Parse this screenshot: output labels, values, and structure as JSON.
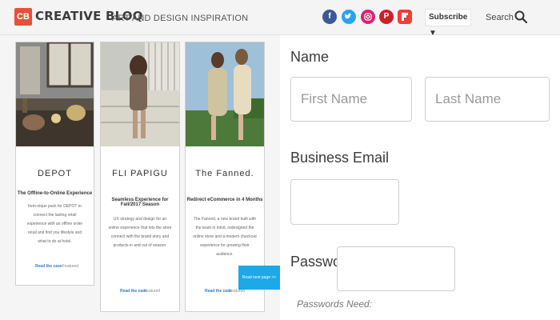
{
  "header": {
    "logo_mark": "CB",
    "logo_text": "CREATIVE BLOQ",
    "tagline": "ART AND DESIGN INSPIRATION",
    "social_icons": [
      "facebook-icon",
      "twitter-icon",
      "instagram-icon",
      "pinterest-icon",
      "flipboard-icon"
    ],
    "subscribe_label": "Subscribe ▼",
    "search_label": "Search"
  },
  "cards": [
    {
      "title": "DEPOT",
      "subtitle": "The Offline-to-Online Experience",
      "body": "Item-nique pack for DEPOT to connect the lasting retail experience with an offline order retail and find you lifestyle and what to do at hotel.",
      "link": "Read the case",
      "tag": "Featured"
    },
    {
      "title": "FLI PAPIGU",
      "subtitle": "Seamless Experience for Fall/2017 Season",
      "body": "UX strategy and design for an online experience that lets the store connect with the brand story and products in and out of season.",
      "link": "Read the case",
      "tag": "Featured"
    },
    {
      "title": "The Fanned.",
      "subtitle": "Redirect eCommerce in 4 Months",
      "body": "The Fanned, a new brand built with the team in mind, redesigned the online store and a modern checkout experience for growing their audience.",
      "link": "Read the case",
      "tag": "Featured"
    }
  ],
  "next_button": "Read next page >>",
  "form": {
    "name_label": "Name",
    "first_name_placeholder": "First Name",
    "last_name_placeholder": "Last Name",
    "email_label": "Business Email",
    "password_label": "Password",
    "password_hint": "Passwords Need:"
  },
  "colors": {
    "brand": "#e8503a",
    "accent": "#1ba9e8",
    "link": "#2a7bd6"
  }
}
